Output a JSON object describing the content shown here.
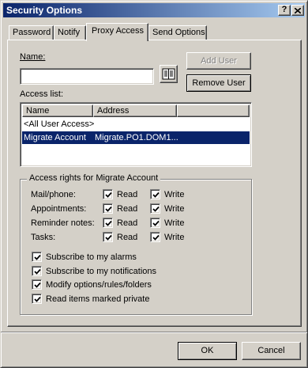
{
  "window": {
    "title": "Security Options",
    "help_glyph": "?",
    "close_glyph": "X"
  },
  "tabs": [
    {
      "label": "Password",
      "active": false
    },
    {
      "label": "Notify",
      "active": false
    },
    {
      "label": "Proxy Access",
      "active": true
    },
    {
      "label": "Send Options",
      "active": false
    }
  ],
  "name_field": {
    "label": "Name:",
    "value": "",
    "address_book_icon": "address-book-icon"
  },
  "buttons": {
    "add_user": "Add User",
    "remove_user": "Remove User",
    "ok": "OK",
    "cancel": "Cancel"
  },
  "access_list": {
    "label": "Access list:",
    "columns": [
      "Name",
      "Address"
    ],
    "rows": [
      {
        "name": "<All User Access>",
        "address": "",
        "selected": false
      },
      {
        "name": "Migrate Account",
        "address": "Migrate.PO1.DOM1...",
        "selected": true
      }
    ]
  },
  "access_rights": {
    "title": "Access rights for Migrate Account",
    "read_label": "Read",
    "write_label": "Write",
    "rows": [
      {
        "label": "Mail/phone:",
        "read": true,
        "write": true
      },
      {
        "label": "Appointments:",
        "read": true,
        "write": true
      },
      {
        "label": "Reminder notes:",
        "read": true,
        "write": true
      },
      {
        "label": "Tasks:",
        "read": true,
        "write": true
      }
    ],
    "options": [
      {
        "label": "Subscribe to my alarms",
        "checked": true
      },
      {
        "label": "Subscribe to my notifications",
        "checked": true
      },
      {
        "label": "Modify options/rules/folders",
        "checked": true
      },
      {
        "label": "Read items marked private",
        "checked": true
      }
    ]
  },
  "colors": {
    "title_bar": "#0a246a",
    "face": "#d4d0c8",
    "selection": "#0a246a"
  }
}
